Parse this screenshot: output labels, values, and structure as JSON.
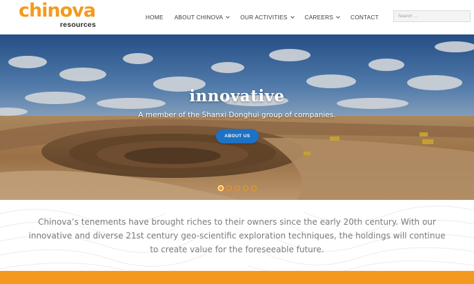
{
  "brand": {
    "name": "chinova",
    "tagline": "resources",
    "colors": {
      "accent": "#f39a1e",
      "button": "#1d72c4"
    }
  },
  "nav": {
    "items": [
      {
        "label": "HOME"
      },
      {
        "label": "ABOUT CHINOVA"
      },
      {
        "label": "OUR ACTIVITIES"
      },
      {
        "label": "CAREERS"
      },
      {
        "label": "CONTACT"
      }
    ]
  },
  "search": {
    "placeholder": "Search ..."
  },
  "hero": {
    "title": "innovative",
    "subtitle": "A member of the Shanxi Donghui group of companies.",
    "button_label": "ABOUT US",
    "slides_total": 5,
    "active_slide": 1
  },
  "intro": {
    "text": "Chinova’s tenements have brought riches to their owners since the early 20th century. With our innovative and diverse 21st century geo-scientific exploration techniques, the holdings will continue to create value for the foreseeable future."
  }
}
